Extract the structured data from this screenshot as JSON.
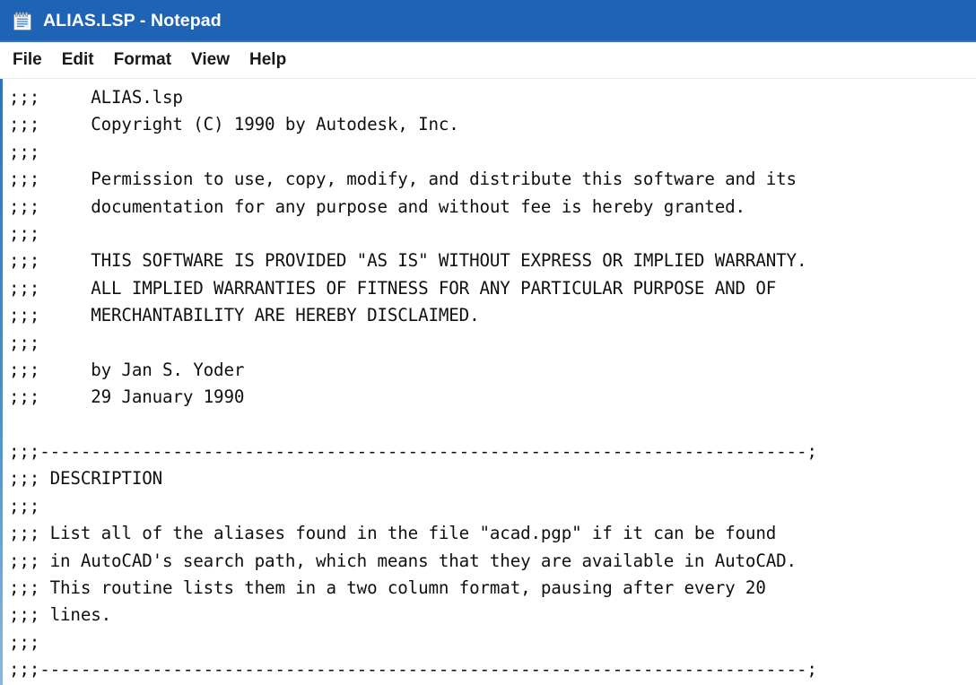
{
  "window": {
    "title": "ALIAS.LSP - Notepad",
    "app_name": "Notepad",
    "file_name": "ALIAS.LSP",
    "icon": "notepad-icon",
    "titlebar_color": "#1f63b5",
    "titlebar_text_color": "#ffffff",
    "editor_background": "#ffffff",
    "editor_text_color": "#101010"
  },
  "menubar": {
    "items": [
      {
        "label": "File",
        "name": "menu-file"
      },
      {
        "label": "Edit",
        "name": "menu-edit"
      },
      {
        "label": "Format",
        "name": "menu-format"
      },
      {
        "label": "View",
        "name": "menu-view"
      },
      {
        "label": "Help",
        "name": "menu-help"
      }
    ]
  },
  "editor": {
    "caret_line_index": 5,
    "caret_column": 27,
    "lines": [
      ";;;     ALIAS.lsp",
      ";;;     Copyright (C) 1990 by Autodesk, Inc.",
      ";;;",
      ";;;     Permission to use, copy, modify, and distribute this software and its",
      ";;;     documentation for any purpose and without fee is hereby granted.",
      ";;;",
      ";;;     THIS SOFTWARE IS PROVIDED \"AS IS\" WITHOUT EXPRESS OR IMPLIED WARRANTY.",
      ";;;     ALL IMPLIED WARRANTIES OF FITNESS FOR ANY PARTICULAR PURPOSE AND OF",
      ";;;     MERCHANTABILITY ARE HEREBY DISCLAIMED.",
      ";;;",
      ";;;     by Jan S. Yoder",
      ";;;     29 January 1990",
      "",
      ";;;---------------------------------------------------------------------------;",
      ";;; DESCRIPTION",
      ";;;",
      ";;; List all of the aliases found in the file \"acad.pgp\" if it can be found",
      ";;; in AutoCAD's search path, which means that they are available in AutoCAD.",
      ";;; This routine lists them in a two column format, pausing after every 20",
      ";;; lines.",
      ";;;",
      ";;;---------------------------------------------------------------------------;"
    ]
  }
}
